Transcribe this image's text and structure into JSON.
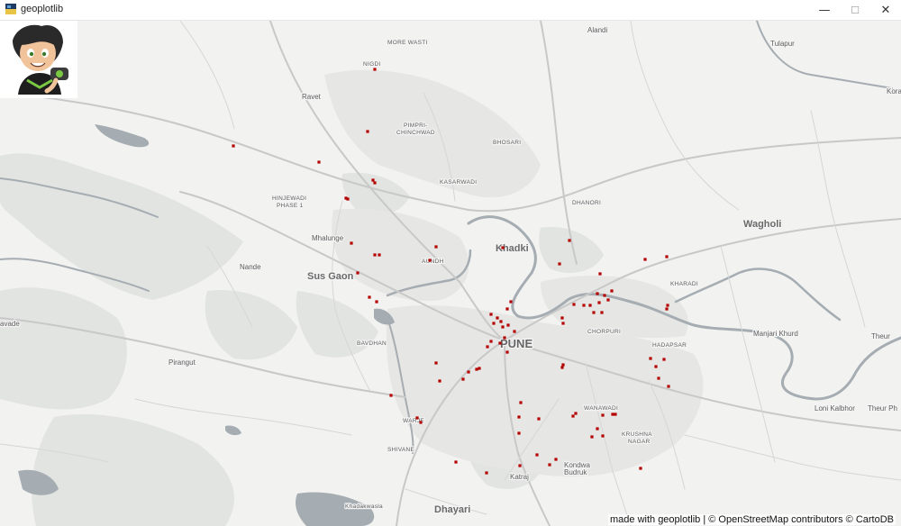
{
  "window": {
    "title": "geoplotlib",
    "controls": {
      "minimize": "—",
      "maximize": "☐",
      "close": "✕"
    }
  },
  "map": {
    "attribution": "made with geoplotlib | © OpenStreetMap contributors © CartoDB",
    "tiles": "CartoDB light",
    "point_color": "#b30000",
    "water_color": "#9ea6ab",
    "land_color": "#f2f2f1",
    "park_color": "#e1e3e1",
    "place_labels": [
      "MORE WASTI",
      "Alandi",
      "Tulapur",
      "NIGDI",
      "Ravet",
      "PIMPRI-",
      "CHINCHWAD",
      "BHOSARI",
      "KASARWADI",
      "HINJEWADI",
      "PHASE 1",
      "DHANORI",
      "Wagholi",
      "Mhalunge",
      "Khadki",
      "AUNDH",
      "Nande",
      "Sus Gaon",
      "KHARADI",
      "PUNE",
      "CHORPURI",
      "Manjari Khurd",
      "Theur",
      "BAVDHAN",
      "HADAPSAR",
      "Pirangut",
      "WANAWADI",
      "Loni Kalbhor",
      "Theur Ph",
      "KRUSHNA",
      "NAGAR",
      "WARJE",
      "SHIVANE",
      "Kondwa",
      "Budruk",
      "Katraj",
      "Khadakwasla",
      "Dhayari",
      "avade",
      "Kora"
    ],
    "logo": "cartoon-avatar"
  }
}
